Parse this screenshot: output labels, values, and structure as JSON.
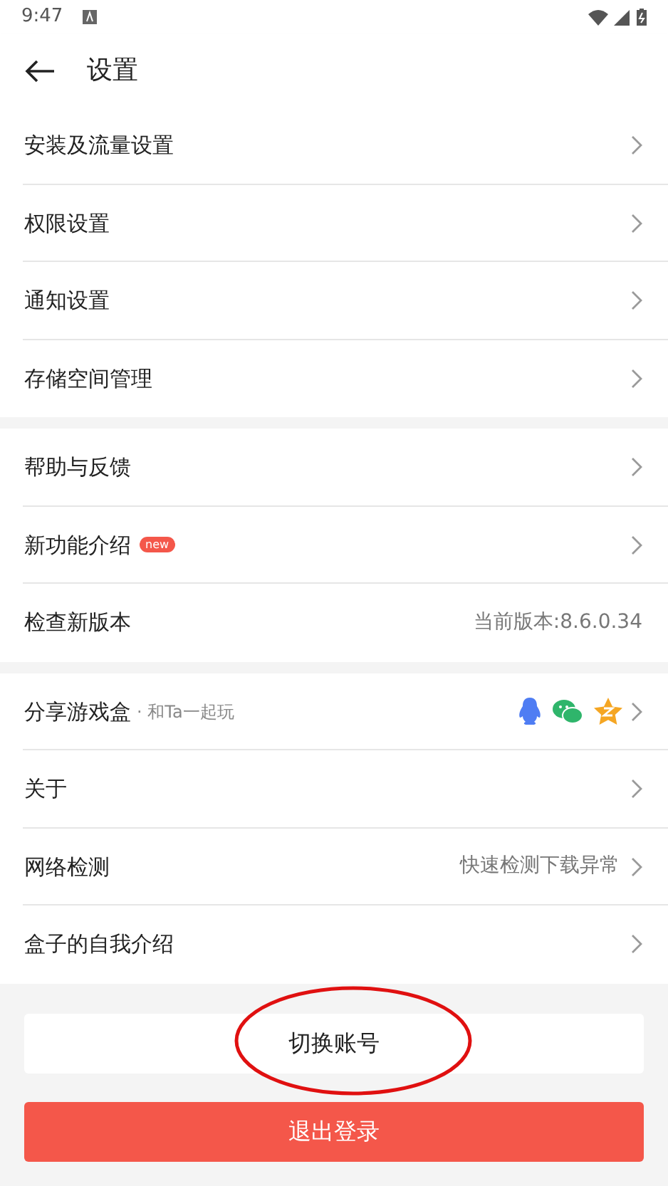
{
  "status_bar": {
    "time": "9:47"
  },
  "header": {
    "title": "设置"
  },
  "groups": [
    {
      "rows": [
        {
          "label": "安装及流量设置",
          "chevron": true
        },
        {
          "label": "权限设置",
          "chevron": true
        },
        {
          "label": "通知设置",
          "chevron": true
        },
        {
          "label": "存储空间管理",
          "chevron": true
        }
      ]
    },
    {
      "rows": [
        {
          "label": "帮助与反馈",
          "chevron": true
        },
        {
          "label": "新功能介绍",
          "badge": "new",
          "chevron": true
        },
        {
          "label": "检查新版本",
          "value": "当前版本:8.6.0.34",
          "chevron": false
        }
      ]
    },
    {
      "rows": [
        {
          "label": "分享游戏盒",
          "subtitle": "· 和Ta一起玩",
          "share_icons": true,
          "chevron": true
        },
        {
          "label": "关于",
          "chevron": true
        },
        {
          "label": "网络检测",
          "value": "快速检测下载异常",
          "chevron": true
        },
        {
          "label": "盒子的自我介绍",
          "chevron": true
        }
      ]
    }
  ],
  "buttons": [
    {
      "label": "切换账号",
      "kind": "secondary"
    },
    {
      "label": "退出登录",
      "kind": "danger"
    }
  ]
}
